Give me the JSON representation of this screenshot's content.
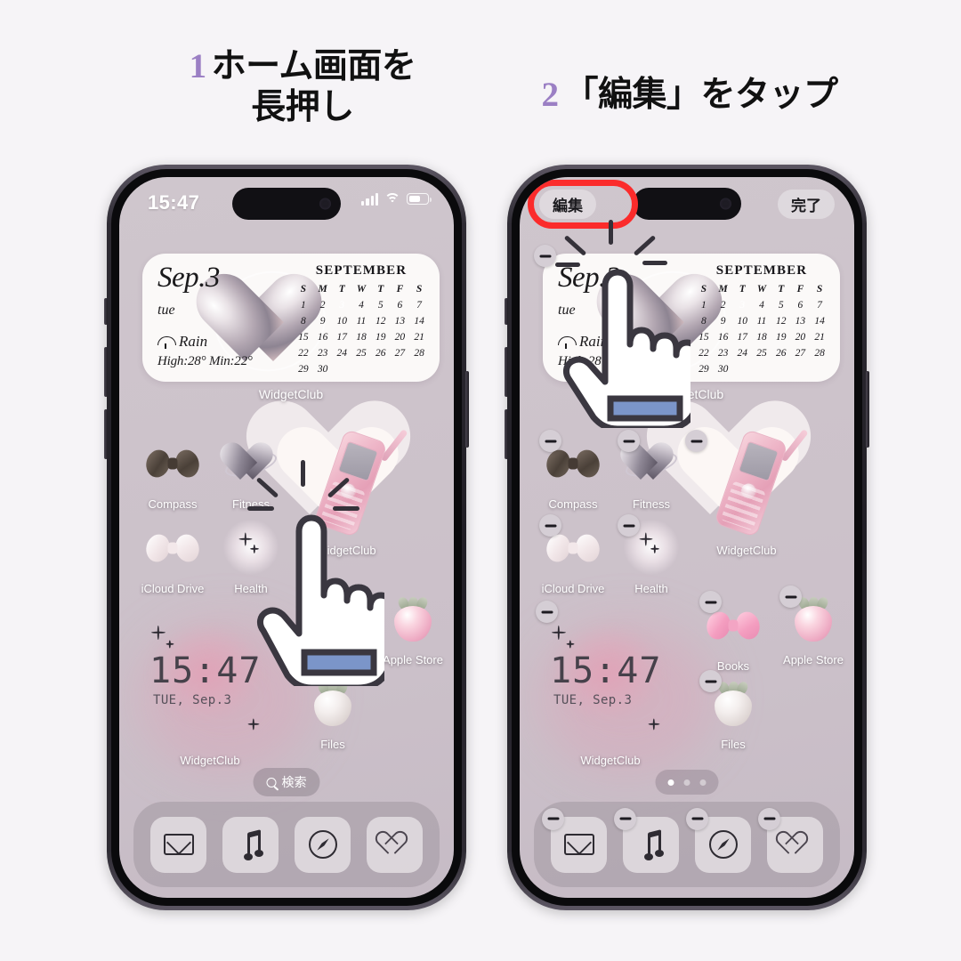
{
  "steps": [
    {
      "num": "1",
      "line1": "ホーム画面を",
      "line2": "長押し"
    },
    {
      "num": "2",
      "line1": "「編集」をタップ",
      "line2": ""
    }
  ],
  "status_bar": {
    "time": "15:47",
    "signal_icon": "cellular-bars-icon",
    "wifi_icon": "wifi-icon",
    "battery_icon": "battery-icon"
  },
  "edit_mode": {
    "edit_label": "編集",
    "done_label": "完了",
    "highlight_color": "#fb2b2b",
    "remove_badge_icon": "minus-badge-icon"
  },
  "widget": {
    "date": "Sep.3",
    "day_of_week": "tue",
    "condition": "Rain",
    "condition_icon": "umbrella-icon",
    "temps": "High:28° Min:22°",
    "label": "WidgetClub",
    "calendar": {
      "month": "SEPTEMBER",
      "dow": [
        "S",
        "M",
        "T",
        "W",
        "T",
        "F",
        "S"
      ],
      "blanks_before": 0,
      "days": [
        1,
        2,
        3,
        4,
        5,
        6,
        7,
        8,
        9,
        10,
        11,
        12,
        13,
        14,
        15,
        16,
        17,
        18,
        19,
        20,
        21,
        22,
        23,
        24,
        25,
        26,
        27,
        28,
        29,
        30
      ],
      "today": 3
    }
  },
  "clock_widget": {
    "time": "15:47",
    "date": "TUE, Sep.3",
    "label": "WidgetClub"
  },
  "apps_left": [
    {
      "label": "Compass",
      "icon": "dark-bow-icon"
    },
    {
      "label": "Fitness",
      "icon": "metal-heart-icon"
    },
    {
      "label": "WidgetClub",
      "icon": "pink-flip-phone-icon"
    },
    {
      "label": "iCloud Drive",
      "icon": "white-bow-icon"
    },
    {
      "label": "Health",
      "icon": "sparkle-icon"
    },
    {
      "label": "Apple Store",
      "icon": "pink-strawberry-icon"
    },
    {
      "label": "Files",
      "icon": "white-strawberry-icon"
    }
  ],
  "apps_right_extra": [
    {
      "label": "Books",
      "icon": "pink-bow-icon"
    }
  ],
  "dock": [
    {
      "label": "Mail",
      "icon": "mail-envelope-icon"
    },
    {
      "label": "Music",
      "icon": "music-note-icon"
    },
    {
      "label": "Safari",
      "icon": "safari-compass-icon"
    },
    {
      "label": "Health",
      "icon": "heart-outline-icon"
    }
  ],
  "search": {
    "label": "検索",
    "icon": "magnifier-icon"
  },
  "page_dots": {
    "count": 3,
    "active_index": 0
  },
  "colors": {
    "background": "#f6f4f7",
    "wallpaper": "#cdc3cb",
    "accent_purple": "#9b7fc4",
    "highlight_red": "#fb2b2b",
    "cursor_cuff": "#7b95c9"
  }
}
